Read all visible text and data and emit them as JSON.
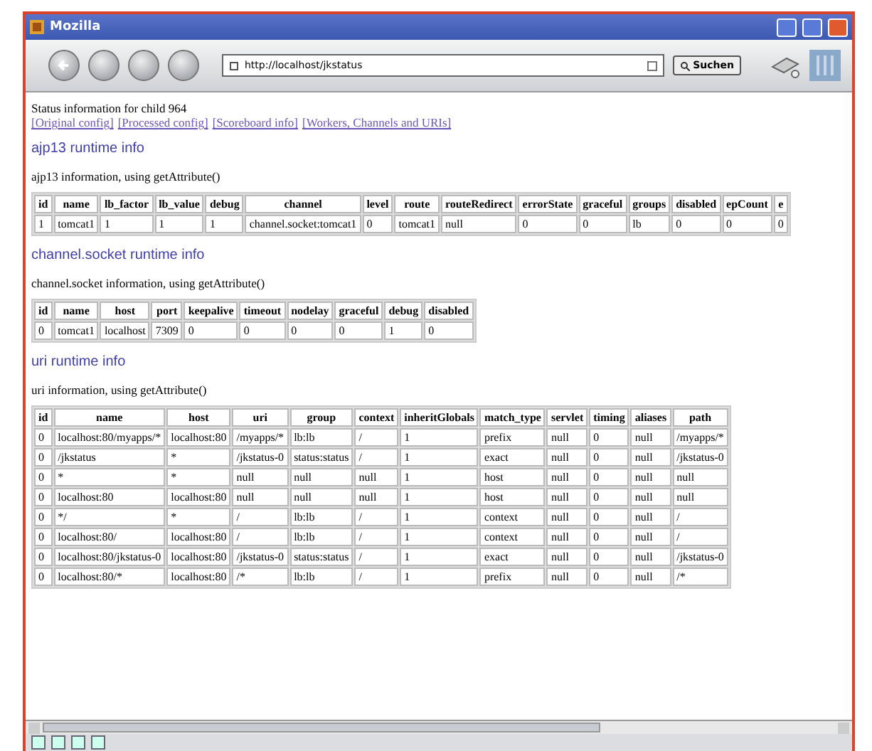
{
  "window": {
    "title": "Mozilla"
  },
  "toolbar": {
    "url": "http://localhost/jkstatus",
    "search_button": "Suchen"
  },
  "page": {
    "heading": "Status information for child 964",
    "links": [
      "[Original config]",
      "[Processed config]",
      "[Scoreboard info]",
      "[Workers, Channels and URIs]"
    ],
    "sections": [
      {
        "title": "ajp13 runtime info",
        "subtitle": "ajp13 information, using getAttribute()",
        "table": {
          "columns": [
            "id",
            "name",
            "lb_factor",
            "lb_value",
            "debug",
            "channel",
            "level",
            "route",
            "routeRedirect",
            "errorState",
            "graceful",
            "groups",
            "disabled",
            "epCount",
            "e"
          ],
          "rows": [
            [
              "1",
              "tomcat1",
              "1",
              "1",
              "1",
              "channel.socket:tomcat1",
              "0",
              "tomcat1",
              "null",
              "0",
              "0",
              "lb",
              "0",
              "0",
              "0"
            ]
          ]
        }
      },
      {
        "title": "channel.socket runtime info",
        "subtitle": "channel.socket information, using getAttribute()",
        "table": {
          "columns": [
            "id",
            "name",
            "host",
            "port",
            "keepalive",
            "timeout",
            "nodelay",
            "graceful",
            "debug",
            "disabled"
          ],
          "rows": [
            [
              "0",
              "tomcat1",
              "localhost",
              "7309",
              "0",
              "0",
              "0",
              "0",
              "1",
              "0"
            ]
          ]
        }
      },
      {
        "title": "uri runtime info",
        "subtitle": "uri information, using getAttribute()",
        "table": {
          "columns": [
            "id",
            "name",
            "host",
            "uri",
            "group",
            "context",
            "inheritGlobals",
            "match_type",
            "servlet",
            "timing",
            "aliases",
            "path"
          ],
          "rows": [
            [
              "0",
              "localhost:80/myapps/*",
              "localhost:80",
              "/myapps/*",
              "lb:lb",
              "/",
              "1",
              "prefix",
              "null",
              "0",
              "null",
              "/myapps/*"
            ],
            [
              "0",
              "/jkstatus",
              "*",
              "/jkstatus-0",
              "status:status",
              "/",
              "1",
              "exact",
              "null",
              "0",
              "null",
              "/jkstatus-0"
            ],
            [
              "0",
              "*",
              "*",
              "null",
              "null",
              "null",
              "1",
              "host",
              "null",
              "0",
              "null",
              "null"
            ],
            [
              "0",
              "localhost:80",
              "localhost:80",
              "null",
              "null",
              "null",
              "1",
              "host",
              "null",
              "0",
              "null",
              "null"
            ],
            [
              "0",
              "*/",
              "*",
              "/",
              "lb:lb",
              "/",
              "1",
              "context",
              "null",
              "0",
              "null",
              "/"
            ],
            [
              "0",
              "localhost:80/",
              "localhost:80",
              "/",
              "lb:lb",
              "/",
              "1",
              "context",
              "null",
              "0",
              "null",
              "/"
            ],
            [
              "0",
              "localhost:80/jkstatus-0",
              "localhost:80",
              "/jkstatus-0",
              "status:status",
              "/",
              "1",
              "exact",
              "null",
              "0",
              "null",
              "/jkstatus-0"
            ],
            [
              "0",
              "localhost:80/*",
              "localhost:80",
              "/*",
              "lb:lb",
              "/",
              "1",
              "prefix",
              "null",
              "0",
              "null",
              "/*"
            ]
          ]
        }
      }
    ]
  }
}
